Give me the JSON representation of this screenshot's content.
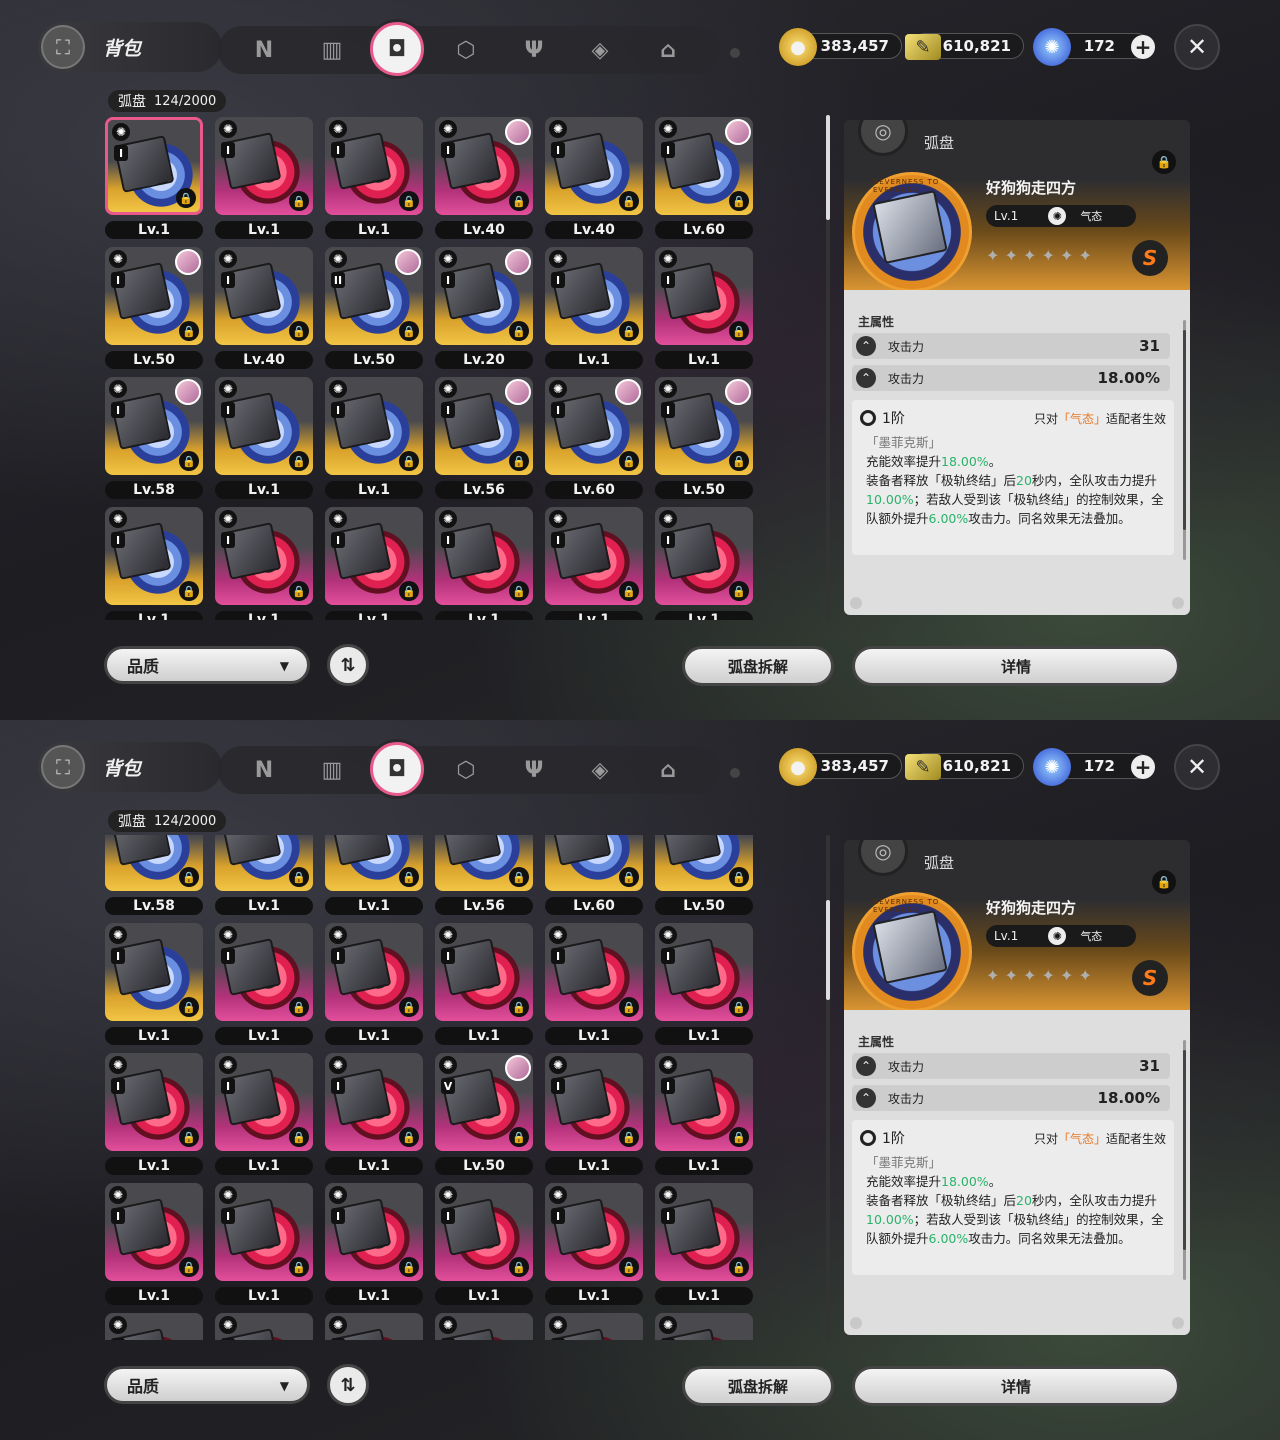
{
  "header": {
    "bag_title": "背包",
    "bag_icon": "backpack-icon",
    "tabs": [
      {
        "icon": "n-logo-icon",
        "glyph": "N"
      },
      {
        "icon": "gameboy-icon",
        "glyph": "▥"
      },
      {
        "icon": "disc-icon",
        "glyph": "◘",
        "active": true
      },
      {
        "icon": "cube-icon",
        "glyph": "⬡"
      },
      {
        "icon": "utensils-icon",
        "glyph": "Ψ"
      },
      {
        "icon": "box-icon",
        "glyph": "◈"
      },
      {
        "icon": "home-icon",
        "glyph": "⌂"
      }
    ],
    "currencies": [
      {
        "icon": "coin-icon",
        "value": "383,457",
        "color": "#e8b93a"
      },
      {
        "icon": "ticket-icon",
        "value": "610,821",
        "color": "#e3c85a"
      },
      {
        "icon": "polychrome-icon",
        "value": "172",
        "color": "#4a7bff"
      }
    ],
    "close": "✕"
  },
  "inventory": {
    "label": "弧盘",
    "count": "124/2000",
    "page1": [
      {
        "lv": "Lv.1",
        "tier": "I",
        "rarity": "gold",
        "selected": true,
        "avatar": false
      },
      {
        "lv": "Lv.1",
        "tier": "I",
        "rarity": "pink",
        "avatar": false
      },
      {
        "lv": "Lv.1",
        "tier": "I",
        "rarity": "pink",
        "avatar": false
      },
      {
        "lv": "Lv.40",
        "tier": "I",
        "rarity": "pink",
        "avatar": true
      },
      {
        "lv": "Lv.40",
        "tier": "I",
        "rarity": "gold",
        "avatar": false
      },
      {
        "lv": "Lv.60",
        "tier": "I",
        "rarity": "gold",
        "avatar": true
      },
      {
        "lv": "Lv.50",
        "tier": "I",
        "rarity": "gold",
        "avatar": true
      },
      {
        "lv": "Lv.40",
        "tier": "I",
        "rarity": "gold",
        "avatar": false
      },
      {
        "lv": "Lv.50",
        "tier": "II",
        "rarity": "gold",
        "avatar": true
      },
      {
        "lv": "Lv.20",
        "tier": "I",
        "rarity": "gold",
        "avatar": true
      },
      {
        "lv": "Lv.1",
        "tier": "I",
        "rarity": "gold",
        "avatar": false
      },
      {
        "lv": "Lv.1",
        "tier": "I",
        "rarity": "pink",
        "avatar": false
      },
      {
        "lv": "Lv.58",
        "tier": "I",
        "rarity": "gold",
        "avatar": true
      },
      {
        "lv": "Lv.1",
        "tier": "I",
        "rarity": "gold",
        "avatar": false
      },
      {
        "lv": "Lv.1",
        "tier": "I",
        "rarity": "gold",
        "avatar": false
      },
      {
        "lv": "Lv.56",
        "tier": "I",
        "rarity": "gold",
        "avatar": true
      },
      {
        "lv": "Lv.60",
        "tier": "I",
        "rarity": "gold",
        "avatar": true
      },
      {
        "lv": "Lv.50",
        "tier": "I",
        "rarity": "gold",
        "avatar": true
      },
      {
        "lv": "Lv.1",
        "tier": "I",
        "rarity": "gold",
        "avatar": false
      },
      {
        "lv": "Lv.1",
        "tier": "I",
        "rarity": "pink",
        "avatar": false
      },
      {
        "lv": "Lv.1",
        "tier": "I",
        "rarity": "pink",
        "avatar": false
      },
      {
        "lv": "Lv.1",
        "tier": "I",
        "rarity": "pink",
        "avatar": false
      },
      {
        "lv": "Lv.1",
        "tier": "I",
        "rarity": "pink",
        "avatar": false
      },
      {
        "lv": "Lv.1",
        "tier": "I",
        "rarity": "pink",
        "avatar": false
      }
    ],
    "page2": [
      {
        "lv": "Lv.58",
        "tier": "I",
        "rarity": "gold",
        "avatar": false
      },
      {
        "lv": "Lv.1",
        "tier": "I",
        "rarity": "gold",
        "avatar": false
      },
      {
        "lv": "Lv.1",
        "tier": "I",
        "rarity": "gold",
        "avatar": false
      },
      {
        "lv": "Lv.56",
        "tier": "I",
        "rarity": "gold",
        "avatar": false
      },
      {
        "lv": "Lv.60",
        "tier": "I",
        "rarity": "gold",
        "avatar": false
      },
      {
        "lv": "Lv.50",
        "tier": "I",
        "rarity": "gold",
        "avatar": false
      },
      {
        "lv": "Lv.1",
        "tier": "I",
        "rarity": "gold",
        "avatar": false
      },
      {
        "lv": "Lv.1",
        "tier": "I",
        "rarity": "pink",
        "avatar": false
      },
      {
        "lv": "Lv.1",
        "tier": "I",
        "rarity": "pink",
        "avatar": false
      },
      {
        "lv": "Lv.1",
        "tier": "I",
        "rarity": "pink",
        "avatar": false
      },
      {
        "lv": "Lv.1",
        "tier": "I",
        "rarity": "pink",
        "avatar": false
      },
      {
        "lv": "Lv.1",
        "tier": "I",
        "rarity": "pink",
        "avatar": false
      },
      {
        "lv": "Lv.1",
        "tier": "I",
        "rarity": "pink",
        "avatar": false
      },
      {
        "lv": "Lv.1",
        "tier": "I",
        "rarity": "pink",
        "avatar": false
      },
      {
        "lv": "Lv.1",
        "tier": "I",
        "rarity": "pink",
        "avatar": false
      },
      {
        "lv": "Lv.50",
        "tier": "V",
        "rarity": "pink",
        "avatar": true
      },
      {
        "lv": "Lv.1",
        "tier": "I",
        "rarity": "pink",
        "avatar": false
      },
      {
        "lv": "Lv.1",
        "tier": "I",
        "rarity": "pink",
        "avatar": false
      },
      {
        "lv": "Lv.1",
        "tier": "I",
        "rarity": "pink",
        "avatar": false
      },
      {
        "lv": "Lv.1",
        "tier": "I",
        "rarity": "pink",
        "avatar": false
      },
      {
        "lv": "Lv.1",
        "tier": "I",
        "rarity": "pink",
        "avatar": false
      },
      {
        "lv": "Lv.1",
        "tier": "I",
        "rarity": "pink",
        "avatar": false
      },
      {
        "lv": "Lv.1",
        "tier": "I",
        "rarity": "pink",
        "avatar": false
      },
      {
        "lv": "Lv.1",
        "tier": "I",
        "rarity": "pink",
        "avatar": false
      },
      {
        "lv": "",
        "tier": "I",
        "rarity": "pink",
        "avatar": false
      },
      {
        "lv": "",
        "tier": "I",
        "rarity": "pink",
        "avatar": false
      },
      {
        "lv": "",
        "tier": "I",
        "rarity": "pink",
        "avatar": false
      },
      {
        "lv": "",
        "tier": "I",
        "rarity": "pink",
        "avatar": false
      },
      {
        "lv": "",
        "tier": "I",
        "rarity": "pink",
        "avatar": false
      },
      {
        "lv": "",
        "tier": "I",
        "rarity": "pink",
        "avatar": false
      }
    ]
  },
  "detail": {
    "category": "弧盘",
    "name": "好狗狗走四方",
    "level": "Lv.1",
    "attribute": "气态",
    "rank": "S",
    "stars": "✦ ✦ ✦ ✦ ✦ ✦",
    "ring_text": "NEVERNESS TO EVERNESS",
    "main_stat_title": "主属性",
    "stats": [
      {
        "name": "攻击力",
        "value": "31"
      },
      {
        "name": "攻击力",
        "value": "18.00%"
      }
    ],
    "effect_tier": "1阶",
    "effect_condition_prefix": "只对",
    "effect_condition_highlight": "「气态」",
    "effect_condition_suffix": "适配者生效",
    "effect_subtitle": "「墨菲克斯」",
    "effect_line1_a": "充能效率提升",
    "effect_line1_g": "18.00%",
    "effect_line1_b": "。",
    "effect_line2_a": "装备者释放「极轨终结」后",
    "effect_line2_g1": "20",
    "effect_line2_b": "秒内，全队攻击力提升",
    "effect_line2_g2": "10.00%",
    "effect_line2_c": "；若敌人受到该「极轨终结」的控制效果，全队额外提升",
    "effect_line2_g3": "6.00%",
    "effect_line2_d": "攻击力。同名效果无法叠加。"
  },
  "footer": {
    "quality": "品质",
    "sort_icon": "sort-icon",
    "dismantle": "弧盘拆解",
    "details": "详情"
  }
}
